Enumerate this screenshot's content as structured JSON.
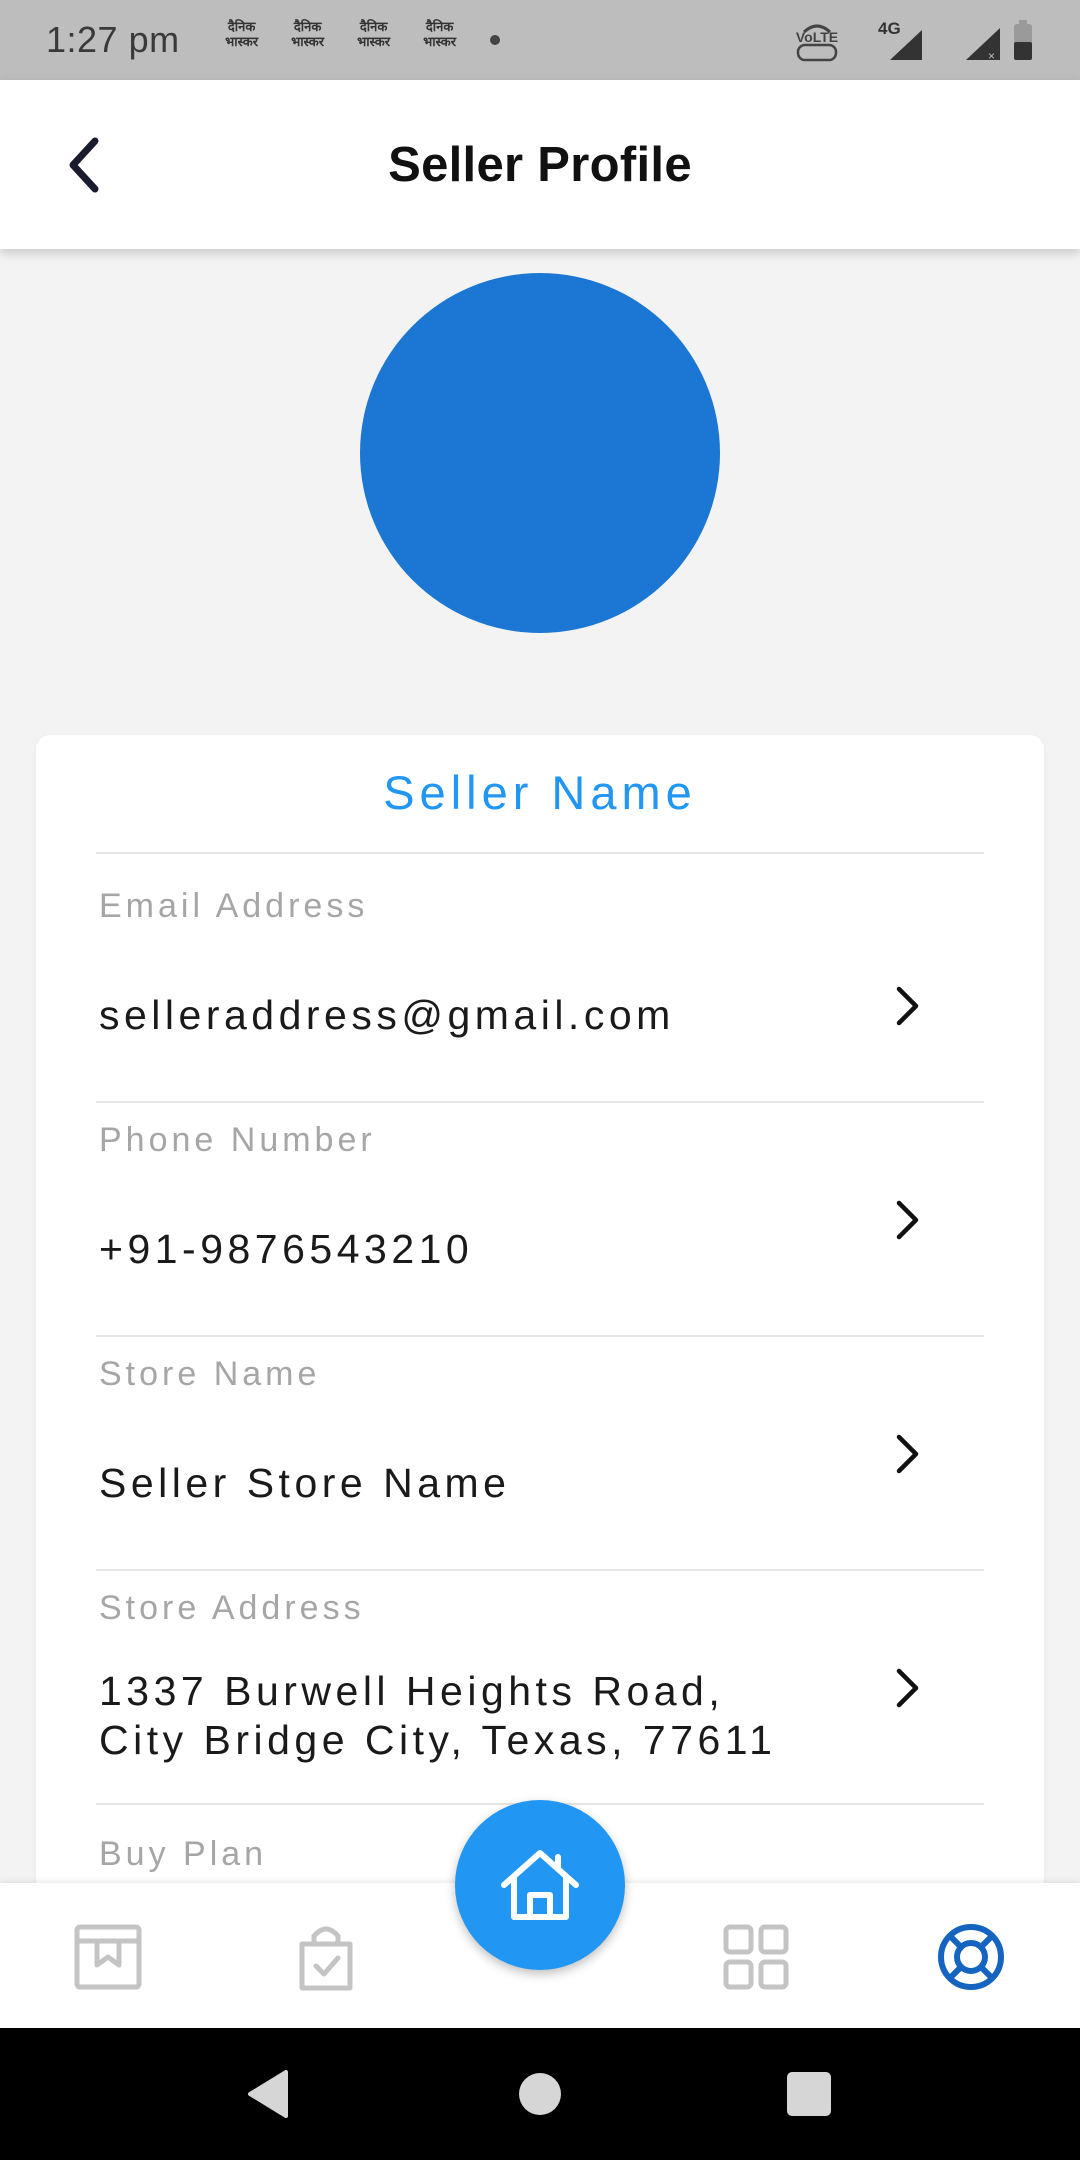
{
  "status_bar": {
    "time": "1:27 pm",
    "notification_icons": [
      {
        "name": "dainik-bhaskar-icon",
        "text": "दैनिक भास्कर"
      },
      {
        "name": "dainik-bhaskar-icon",
        "text": "दैनिक भास्कर"
      },
      {
        "name": "dainik-bhaskar-icon",
        "text": "दैनिक भास्कर"
      },
      {
        "name": "dainik-bhaskar-icon",
        "text": "दैनिक भास्कर"
      }
    ],
    "network_label": "4G",
    "volte_label": "VoLTE"
  },
  "app_bar": {
    "title": "Seller Profile"
  },
  "profile": {
    "avatar_color": "#1b77d3",
    "seller_name": "Seller Name",
    "fields": [
      {
        "label": "Email Address",
        "value": "selleraddress@gmail.com"
      },
      {
        "label": "Phone Number",
        "value": "+91-9876543210"
      },
      {
        "label": "Store Name",
        "value": "Seller Store Name"
      },
      {
        "label": "Store Address",
        "value_line1": "1337 Burwell Heights Road,",
        "value_line2": "City Bridge City, Texas, 77611"
      },
      {
        "label": "Buy Plan"
      }
    ]
  },
  "bottom_nav": {
    "items": [
      {
        "icon": "store-icon",
        "active": false
      },
      {
        "icon": "shopping-bag-check-icon",
        "active": false
      },
      {
        "icon": "home-icon",
        "active": true
      },
      {
        "icon": "grid-icon",
        "active": false
      },
      {
        "icon": "support-lifebuoy-icon",
        "active": true
      }
    ]
  },
  "colors": {
    "accent": "#2196f3",
    "avatar": "#1b77d3",
    "active_nav": "#1565c0",
    "inactive_nav": "#c4c4c4"
  }
}
